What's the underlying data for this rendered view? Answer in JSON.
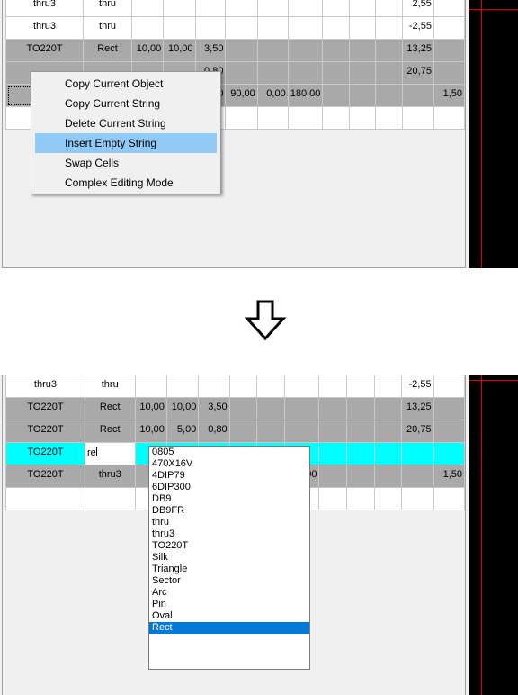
{
  "top_grid": {
    "rows": [
      {
        "style": "white",
        "cells": [
          "thru3",
          "thru",
          "",
          "",
          "",
          "",
          "",
          "",
          "",
          "",
          "",
          "2,55",
          ""
        ]
      },
      {
        "style": "white",
        "cells": [
          "thru3",
          "thru",
          "",
          "",
          "",
          "",
          "",
          "",
          "",
          "",
          "",
          "-2,55",
          ""
        ]
      },
      {
        "style": "gray",
        "cells": [
          "TO220T",
          "Rect",
          "10,00",
          "10,00",
          "3,50",
          "",
          "",
          "",
          "",
          "",
          "",
          "13,25",
          ""
        ]
      },
      {
        "style": "gray",
        "cells": [
          "",
          "",
          "",
          "",
          "0,80",
          "",
          "",
          "",
          "",
          "",
          "",
          "20,75",
          ""
        ]
      },
      {
        "style": "gray",
        "cells": [
          "",
          "",
          "",
          "",
          "5,00",
          "90,00",
          "0,00",
          "180,00",
          "",
          "",
          "",
          "",
          "1,50"
        ]
      },
      {
        "style": "white",
        "cells": [
          "",
          "",
          "",
          "",
          "",
          "",
          "",
          "",
          "",
          "",
          "",
          "",
          ""
        ]
      }
    ]
  },
  "context_menu": {
    "items": [
      {
        "label": "Copy Current Object",
        "highlighted": false
      },
      {
        "label": "Copy Current String",
        "highlighted": false
      },
      {
        "label": "Delete Current String",
        "highlighted": false
      },
      {
        "label": "Insert Empty String",
        "highlighted": true
      },
      {
        "label": "Swap Cells",
        "highlighted": false
      },
      {
        "label": "Complex Editing Mode",
        "highlighted": false
      }
    ]
  },
  "bottom_grid": {
    "rows": [
      {
        "style": "white",
        "cells": [
          "thru3",
          "thru",
          "",
          "",
          "",
          "",
          "",
          "",
          "",
          "",
          "",
          "-2,55",
          ""
        ]
      },
      {
        "style": "gray",
        "cells": [
          "TO220T",
          "Rect",
          "10,00",
          "10,00",
          "3,50",
          "",
          "",
          "",
          "",
          "",
          "",
          "13,25",
          ""
        ]
      },
      {
        "style": "gray",
        "cells": [
          "TO220T",
          "Rect",
          "10,00",
          "5,00",
          "0,80",
          "",
          "",
          "",
          "",
          "",
          "",
          "20,75",
          ""
        ]
      },
      {
        "style": "cyan",
        "cells": [
          "TO220T",
          "re",
          "",
          "",
          "",
          "",
          "",
          "",
          "",
          "",
          "",
          "",
          ""
        ]
      },
      {
        "style": "gray",
        "cells": [
          "TO220T",
          "thru3",
          "",
          "",
          "",
          "",
          "",
          "180,00",
          "",
          "",
          "",
          "",
          "1,50"
        ]
      },
      {
        "style": "white",
        "cells": [
          "",
          "",
          "",
          "",
          "",
          "",
          "",
          "",
          "",
          "",
          "",
          "",
          ""
        ]
      }
    ],
    "edit_value": "re"
  },
  "dropdown": {
    "options": [
      "0805",
      "470X16V",
      "4DIP79",
      "6DIP300",
      "DB9",
      "DB9FR",
      "thru",
      "thru3",
      "TO220T",
      "Silk",
      "Triangle",
      "Sector",
      "Arc",
      "Pin",
      "Oval",
      "Rect"
    ],
    "selected": "Rect"
  },
  "colors": {
    "row_gray": "#a9a9a9",
    "row_cyan": "#00ffff",
    "menu_highlight": "#91c9f7",
    "dropdown_selected": "#0078d7",
    "red_lines": "#e00000"
  },
  "icons": {
    "transition_arrow": "down-arrow-icon"
  }
}
